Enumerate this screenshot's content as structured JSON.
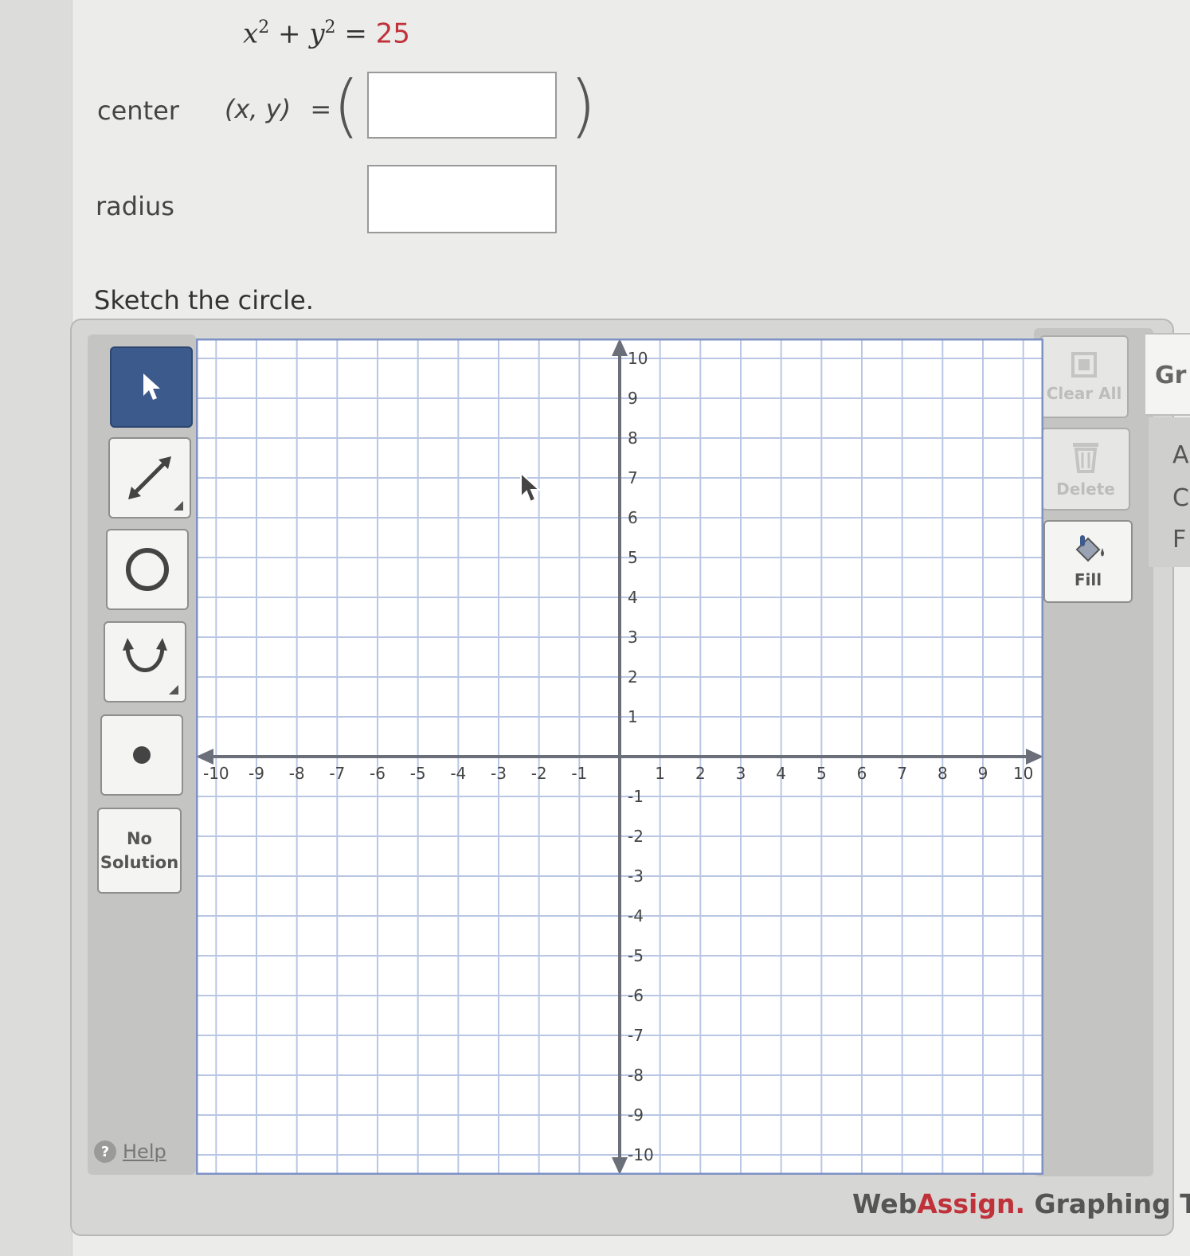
{
  "equation": {
    "lhs_x": "x",
    "lhs_x_exp": "2",
    "plus": "+",
    "lhs_y": "y",
    "lhs_y_exp": "2",
    "equals": "=",
    "rhs": "25"
  },
  "center": {
    "label": "center",
    "xy_label": "(x, y)",
    "equals": "=",
    "open_paren": "(",
    "close_paren": ")",
    "value": ""
  },
  "radius": {
    "label": "radius",
    "value": ""
  },
  "instruction": "Sketch the circle.",
  "tools": {
    "no_solution_line1": "No",
    "no_solution_line2": "Solution",
    "help": "Help",
    "help_icon_glyph": "?",
    "clear_all": "Clear All",
    "delete": "Delete",
    "fill": "Fill"
  },
  "brand": {
    "web": "WebAssign",
    "assign_split": "Web",
    "assign_red": "Assign",
    "dot": ".",
    "tool": " Graphing Tool"
  },
  "side_tab": {
    "title": "Gr",
    "line1": "A",
    "line2": "C",
    "line3": "F"
  },
  "graph": {
    "x_min": -10.5,
    "x_max": 10.5,
    "y_min": -10.5,
    "y_max": 10.5,
    "grid_step": 1,
    "x_tick_labels": [
      "-10",
      "-9",
      "-8",
      "-7",
      "-6",
      "-5",
      "-4",
      "-3",
      "-2",
      "-1",
      "1",
      "2",
      "3",
      "4",
      "5",
      "6",
      "7",
      "8",
      "9",
      "10"
    ],
    "y_tick_labels": [
      "10",
      "9",
      "8",
      "7",
      "6",
      "5",
      "4",
      "3",
      "2",
      "1",
      "-1",
      "-2",
      "-3",
      "-4",
      "-5",
      "-6",
      "-7",
      "-8",
      "-9",
      "-10"
    ],
    "colors": {
      "grid": "#b9c7e4",
      "axis": "#6b6f7a",
      "border": "#7e91c4",
      "background": "#ffffff"
    }
  },
  "icons": {
    "pointer": "pointer-icon",
    "line": "line-tool-icon",
    "circle": "circle-tool-icon",
    "parabola": "parabola-tool-icon",
    "point": "point-tool-icon",
    "clear_all": "clear-all-icon",
    "delete": "trash-icon",
    "fill": "fill-bucket-icon",
    "help": "help-icon"
  }
}
